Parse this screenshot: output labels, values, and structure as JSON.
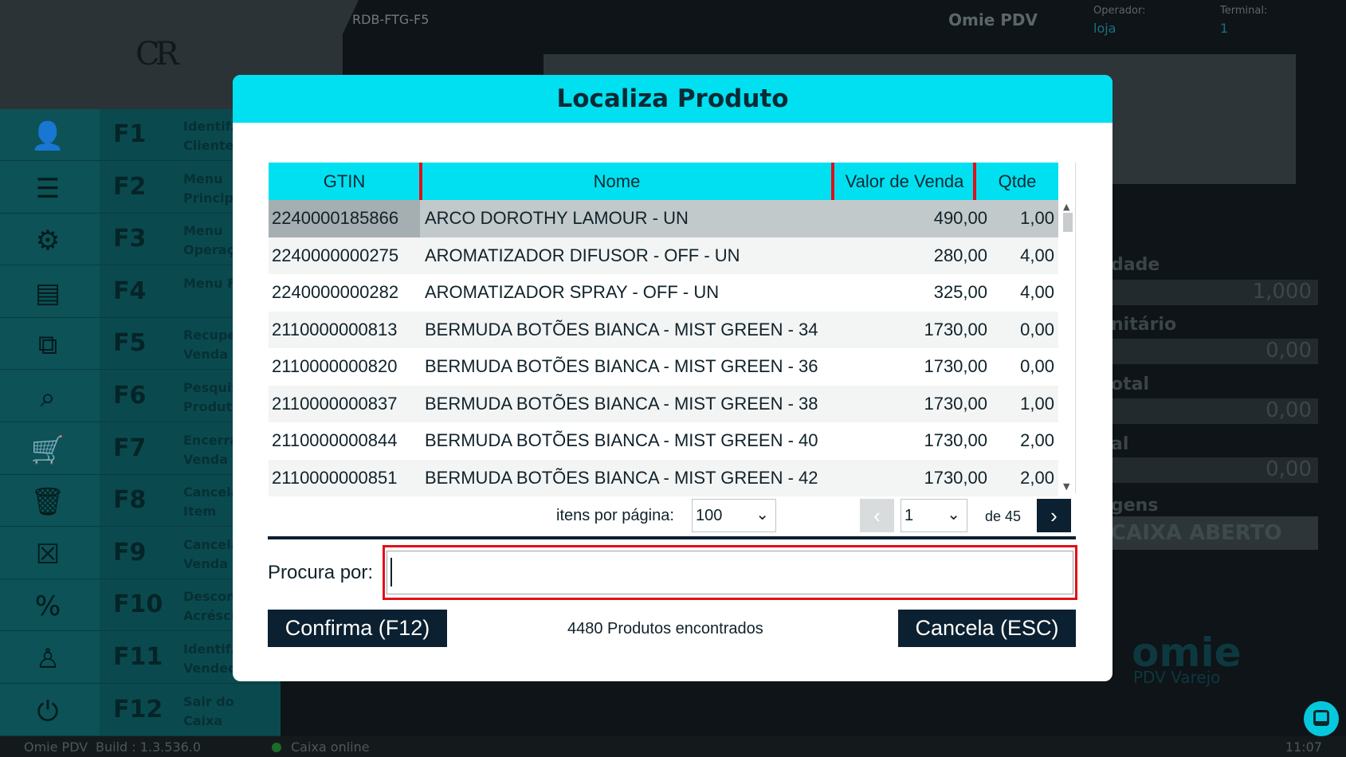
{
  "app": {
    "logo_text": "CR",
    "terminal_code": "RDB-FTG-F5",
    "title": "Omie PDV",
    "operator_label": "Operador:",
    "operator_value": "loja",
    "terminal_label": "Terminal:",
    "terminal_value": "1"
  },
  "sidebar": {
    "items": [
      {
        "key": "F1",
        "label": "Identif. Cliente",
        "icon": "user-icon"
      },
      {
        "key": "F2",
        "label": "Menu Principal",
        "icon": "menu-icon"
      },
      {
        "key": "F3",
        "label": "Menu Operação",
        "icon": "gear-icon"
      },
      {
        "key": "F4",
        "label": "Menu Fiscal",
        "icon": "receipt-icon"
      },
      {
        "key": "F5",
        "label": "Recuperar Venda",
        "icon": "recover-icon"
      },
      {
        "key": "F6",
        "label": "Pesquisar Produto",
        "icon": "search-icon"
      },
      {
        "key": "F7",
        "label": "Encerrar Venda",
        "icon": "cart-icon"
      },
      {
        "key": "F8",
        "label": "Cancelar Item",
        "icon": "trash-icon"
      },
      {
        "key": "F9",
        "label": "Cancelar Venda",
        "icon": "close-box-icon"
      },
      {
        "key": "F10",
        "label": "Desconto Acréscimo",
        "icon": "percent-icon"
      },
      {
        "key": "F11",
        "label": "Identif. Vendedor",
        "icon": "seller-icon"
      },
      {
        "key": "F12",
        "label": "Sair do Caixa",
        "icon": "power-icon"
      }
    ]
  },
  "right_panel": {
    "labels": [
      "dade",
      "nitário",
      "otal",
      "al",
      "gens"
    ],
    "values": [
      "1,000",
      "0,00",
      "0,00",
      "0,00"
    ],
    "caixa_status": "CAIXA ABERTO",
    "brand": "omie",
    "brand_sub": "PDV Varejo"
  },
  "modal": {
    "title": "Localiza Produto",
    "columns": [
      "GTIN",
      "Nome",
      "Valor de Venda",
      "Qtde"
    ],
    "rows": [
      {
        "gtin": "2240000185866",
        "nome": "ARCO DOROTHY LAMOUR - UN",
        "valor": "490,00",
        "qtde": "1,00"
      },
      {
        "gtin": "2240000000275",
        "nome": "AROMATIZADOR DIFUSOR - OFF - UN",
        "valor": "280,00",
        "qtde": "4,00"
      },
      {
        "gtin": "2240000000282",
        "nome": "AROMATIZADOR SPRAY - OFF - UN",
        "valor": "325,00",
        "qtde": "4,00"
      },
      {
        "gtin": "2110000000813",
        "nome": "BERMUDA BOTÕES BIANCA - MIST GREEN - 34",
        "valor": "1730,00",
        "qtde": "0,00"
      },
      {
        "gtin": "2110000000820",
        "nome": "BERMUDA BOTÕES BIANCA - MIST GREEN - 36",
        "valor": "1730,00",
        "qtde": "0,00"
      },
      {
        "gtin": "2110000000837",
        "nome": "BERMUDA BOTÕES BIANCA - MIST GREEN - 38",
        "valor": "1730,00",
        "qtde": "1,00"
      },
      {
        "gtin": "2110000000844",
        "nome": "BERMUDA BOTÕES BIANCA - MIST GREEN - 40",
        "valor": "1730,00",
        "qtde": "2,00"
      },
      {
        "gtin": "2110000000851",
        "nome": "BERMUDA BOTÕES BIANCA - MIST GREEN - 42",
        "valor": "1730,00",
        "qtde": "2,00"
      }
    ],
    "pager": {
      "items_per_page_label": "itens por página:",
      "items_per_page_value": "100",
      "page_value": "1",
      "page_total": "de 45"
    },
    "search": {
      "label": "Procura por:",
      "value": ""
    },
    "confirm_label": "Confirma (F12)",
    "cancel_label": "Cancela (ESC)",
    "found_text": "4480 Produtos encontrados"
  },
  "statusbar": {
    "app": "Omie PDV",
    "build": "Build : 1.3.536.0",
    "connection": "Caixa online",
    "time": "11:07"
  }
}
